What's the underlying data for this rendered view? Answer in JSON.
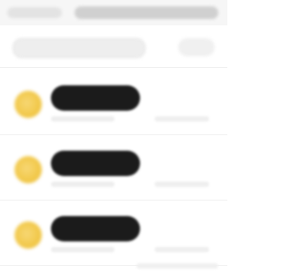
{
  "window": {
    "tab_label": "",
    "title": ""
  },
  "toolbar": {
    "search_placeholder": "",
    "filter_label": ""
  },
  "list": {
    "items": [
      {
        "name": "",
        "meta": "",
        "right_meta": ""
      },
      {
        "name": "",
        "meta": "",
        "right_meta": ""
      },
      {
        "name": "",
        "meta": "",
        "right_meta": ""
      }
    ]
  },
  "footer": {
    "text": ""
  }
}
